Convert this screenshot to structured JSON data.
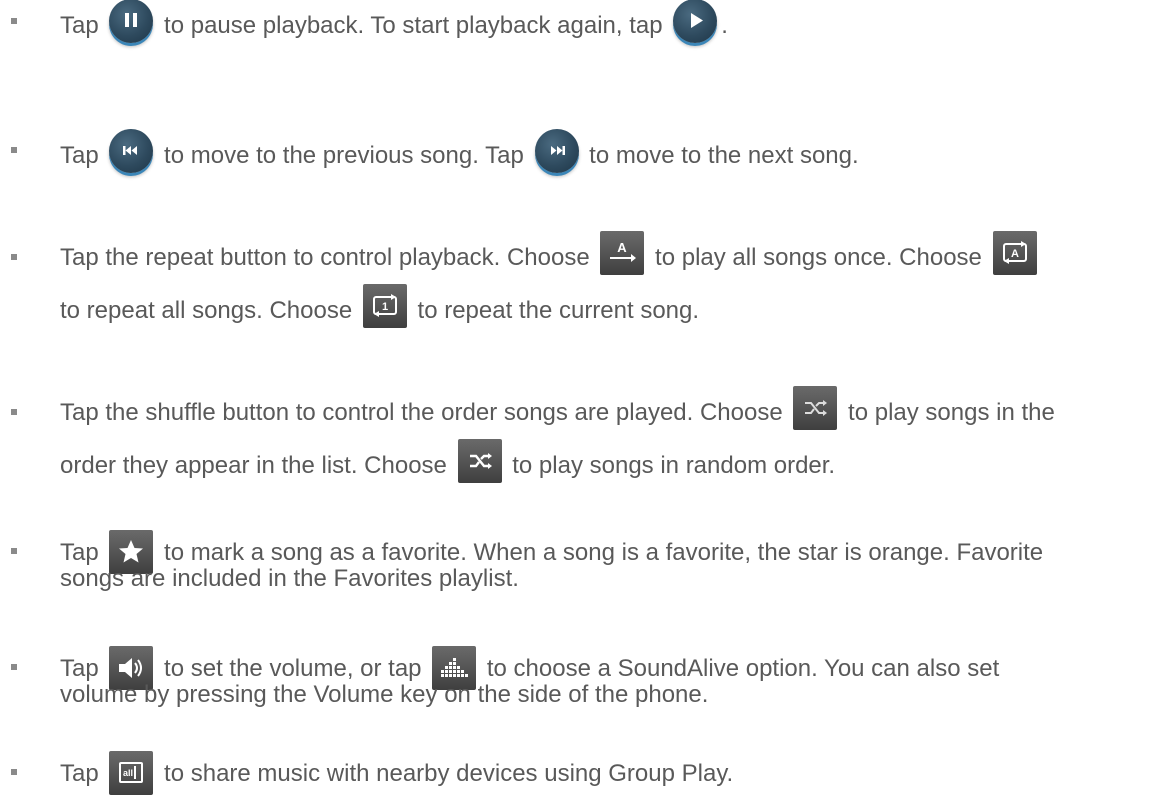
{
  "items": [
    {
      "parts": [
        "Tap",
        "to pause playback. To start playback again, tap",
        "."
      ],
      "icons": [
        "pause-icon",
        "play-icon"
      ]
    },
    {
      "parts": [
        "Tap",
        "to move to the previous song. Tap",
        "to move to the next song."
      ],
      "icons": [
        "previous-icon",
        "next-icon"
      ]
    },
    {
      "parts": [
        "Tap the repeat button to control playback. Choose",
        "to play all songs once. Choose",
        "to repeat all songs. Choose",
        "to repeat the current song."
      ],
      "icons": [
        "repeat-off-icon",
        "repeat-all-icon",
        "repeat-one-icon"
      ]
    },
    {
      "parts": [
        "Tap the shuffle button to control the order songs are played. Choose",
        "to play songs in the",
        "order they appear in the list. Choose",
        "to play songs in random order."
      ],
      "icons": [
        "shuffle-off-icon",
        "shuffle-on-icon"
      ]
    },
    {
      "parts": [
        "Tap",
        "to mark a song as a favorite. When a song is a favorite, the star is orange. Favorite",
        "songs are included in the Favorites playlist."
      ],
      "icons": [
        "favorite-star-icon"
      ]
    },
    {
      "parts": [
        "Tap",
        "to set the volume, or tap",
        "to choose a SoundAlive option. You can also set",
        "volume by pressing the Volume key on the side of the phone."
      ],
      "icons": [
        "volume-icon",
        "soundalive-icon"
      ]
    },
    {
      "parts": [
        "Tap",
        "to share music with nearby devices using Group Play."
      ],
      "icons": [
        "group-play-icon"
      ]
    }
  ]
}
